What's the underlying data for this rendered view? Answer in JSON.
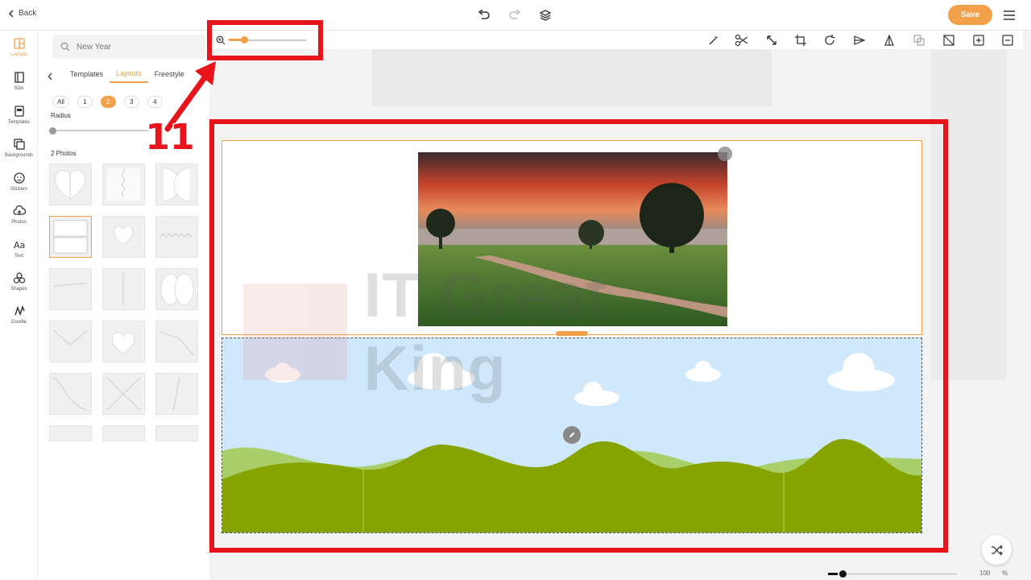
{
  "header": {
    "back_label": "Back",
    "save_label": "Save",
    "accent_color": "#f2a04a"
  },
  "rail": [
    {
      "label": "Layouts",
      "icon": "layout-icon",
      "active": true
    },
    {
      "label": "Size",
      "icon": "size-icon"
    },
    {
      "label": "Templates",
      "icon": "templates-icon"
    },
    {
      "label": "Backgrounds",
      "icon": "backgrounds-icon"
    },
    {
      "label": "Stickers",
      "icon": "smiley-icon"
    },
    {
      "label": "Photos",
      "icon": "cloud-upload-icon"
    },
    {
      "label": "Text",
      "icon": "text-icon"
    },
    {
      "label": "Shapes",
      "icon": "shapes-icon"
    },
    {
      "label": "Doodle",
      "icon": "doodle-icon"
    }
  ],
  "panel": {
    "search_placeholder": "New Year",
    "tabs": [
      "Templates",
      "Layouts",
      "Freestyle"
    ],
    "active_tab": "Layouts",
    "filters": [
      "All",
      "1",
      "2",
      "3",
      "4"
    ],
    "active_filter": "2",
    "radius_label": "Radius",
    "radius_value": 0,
    "section_title": "2 Photos"
  },
  "zoom": {
    "level_fraction": 0.16
  },
  "annotation": {
    "step_number": "11",
    "highlight_color": "#e8141b"
  },
  "watermark": {
    "text": "IT Great King"
  },
  "bottom_zoom": {
    "value": "100",
    "unit": "%"
  }
}
